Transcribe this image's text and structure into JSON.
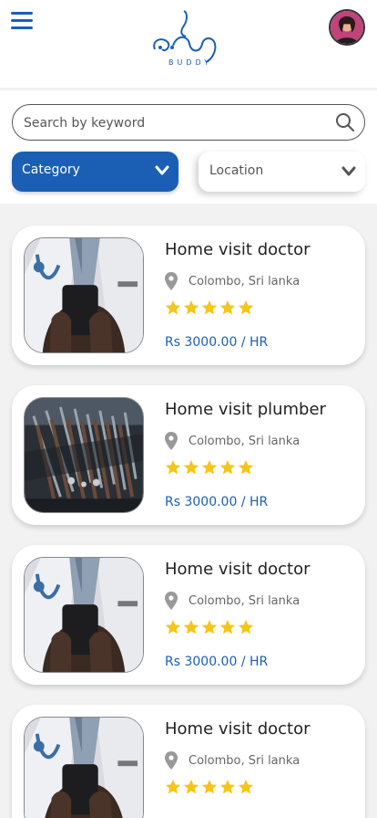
{
  "header": {
    "menu_icon": "hamburger-menu-icon",
    "logo_text": "BUDDY",
    "avatar_icon": "user-avatar"
  },
  "search": {
    "placeholder": "Search by keyword",
    "icon": "search-icon"
  },
  "filters": {
    "category_label": "Category",
    "location_label": "Location"
  },
  "listings": [
    {
      "title": "Home visit doctor",
      "location": "Colombo, Sri lanka",
      "rating": 5,
      "price": "Rs 3000.00 / HR",
      "image": "doctor"
    },
    {
      "title": "Home visit plumber",
      "location": "Colombo, Sri lanka",
      "rating": 5,
      "price": "Rs 3000.00 / HR",
      "image": "tools"
    },
    {
      "title": "Home visit doctor",
      "location": "Colombo, Sri lanka",
      "rating": 5,
      "price": "Rs 3000.00 / HR",
      "image": "doctor"
    },
    {
      "title": "Home visit doctor",
      "location": "Colombo, Sri lanka",
      "rating": 5,
      "price": "",
      "image": "doctor"
    }
  ],
  "colors": {
    "brand": "#1a5fb4",
    "star": "#f5c518",
    "pin": "#999999"
  }
}
